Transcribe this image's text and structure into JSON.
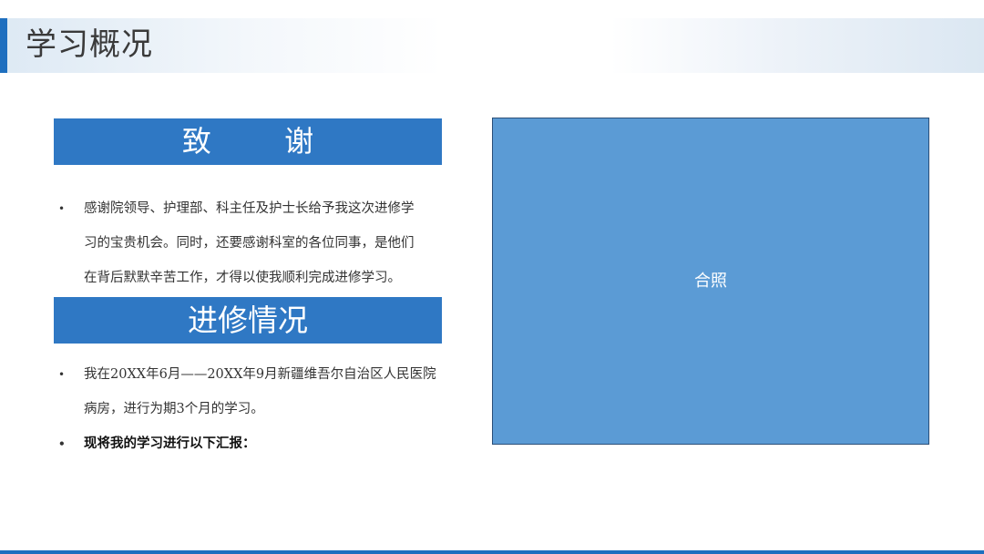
{
  "header": {
    "title": "学习概况"
  },
  "thanks_section": {
    "title": "致 谢",
    "paragraph_lines": [
      "感谢院领导、护理部、科主任及护士长给予我这次进修学",
      "习的宝贵机会。同时，还要感谢科室的各位同事，是他们",
      "在背后默默辛苦工作，才得以使我顺利完成进修学习。"
    ]
  },
  "study_section": {
    "title": "进修情况",
    "item1_lines": [
      "我在20XX年6月——20XX年9月新疆维吾尔自治区人民医院",
      "病房，进行为期3个月的学习。"
    ],
    "item2": "现将我的学习进行以下汇报："
  },
  "photo": {
    "label": "合照"
  },
  "colors": {
    "accent": "#1e6fbf",
    "section_header": "#2f78c4",
    "photo_fill": "#5b9bd5"
  }
}
